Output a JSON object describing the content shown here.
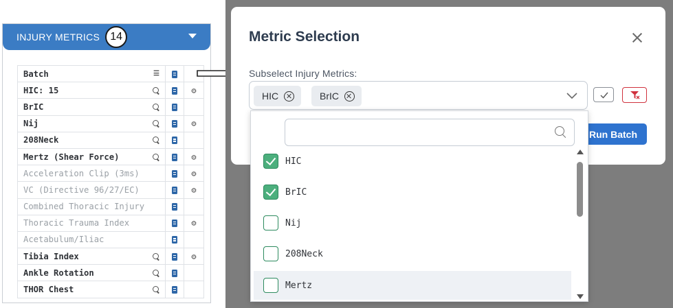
{
  "left_panel": {
    "header_title": "INJURY METRICS",
    "count": "14",
    "rows": [
      {
        "label": "Batch",
        "active": true,
        "icon": "list-check-icon",
        "book": true,
        "gear": false
      },
      {
        "label": "HIC: 15",
        "active": true,
        "icon": "search-icon",
        "book": true,
        "gear": true
      },
      {
        "label": "BrIC",
        "active": true,
        "icon": "search-icon",
        "book": true,
        "gear": false
      },
      {
        "label": "Nij",
        "active": true,
        "icon": "search-icon",
        "book": true,
        "gear": true
      },
      {
        "label": "208Neck",
        "active": true,
        "icon": "search-icon",
        "book": true,
        "gear": false
      },
      {
        "label": "Mertz (Shear Force)",
        "active": true,
        "icon": "search-icon",
        "book": true,
        "gear": true
      },
      {
        "label": "Acceleration Clip (3ms)",
        "active": false,
        "icon": "",
        "book": true,
        "gear": true
      },
      {
        "label": "VC (Directive 96/27/EC)",
        "active": false,
        "icon": "",
        "book": true,
        "gear": true
      },
      {
        "label": "Combined Thoracic Injury",
        "active": false,
        "icon": "",
        "book": true,
        "gear": false
      },
      {
        "label": "Thoracic Trauma Index",
        "active": false,
        "icon": "",
        "book": true,
        "gear": true
      },
      {
        "label": "Acetabulum/Iliac",
        "active": false,
        "icon": "",
        "book": true,
        "gear": false
      },
      {
        "label": "Tibia Index",
        "active": true,
        "icon": "search-icon",
        "book": true,
        "gear": true
      },
      {
        "label": "Ankle Rotation",
        "active": true,
        "icon": "search-icon",
        "book": true,
        "gear": false
      },
      {
        "label": "THOR Chest",
        "active": true,
        "icon": "search-icon",
        "book": true,
        "gear": false
      }
    ]
  },
  "modal": {
    "title": "Metric Selection",
    "subselect_label": "Subselect Injury Metrics:",
    "chips": [
      "HIC",
      "BrIC"
    ],
    "run_batch_label": "Run Batch"
  },
  "dropdown": {
    "search_placeholder": "",
    "options": [
      {
        "label": "HIC",
        "checked": true
      },
      {
        "label": "BrIC",
        "checked": true
      },
      {
        "label": "Nij",
        "checked": false
      },
      {
        "label": "208Neck",
        "checked": false
      },
      {
        "label": "Mertz",
        "checked": false
      }
    ]
  },
  "colors": {
    "header_blue": "#3b7cc4",
    "run_batch_blue": "#2e73cf",
    "checkbox_green": "#4caf7d",
    "filter_red": "#d0313d",
    "backdrop_gray": "#7d7d7d"
  }
}
